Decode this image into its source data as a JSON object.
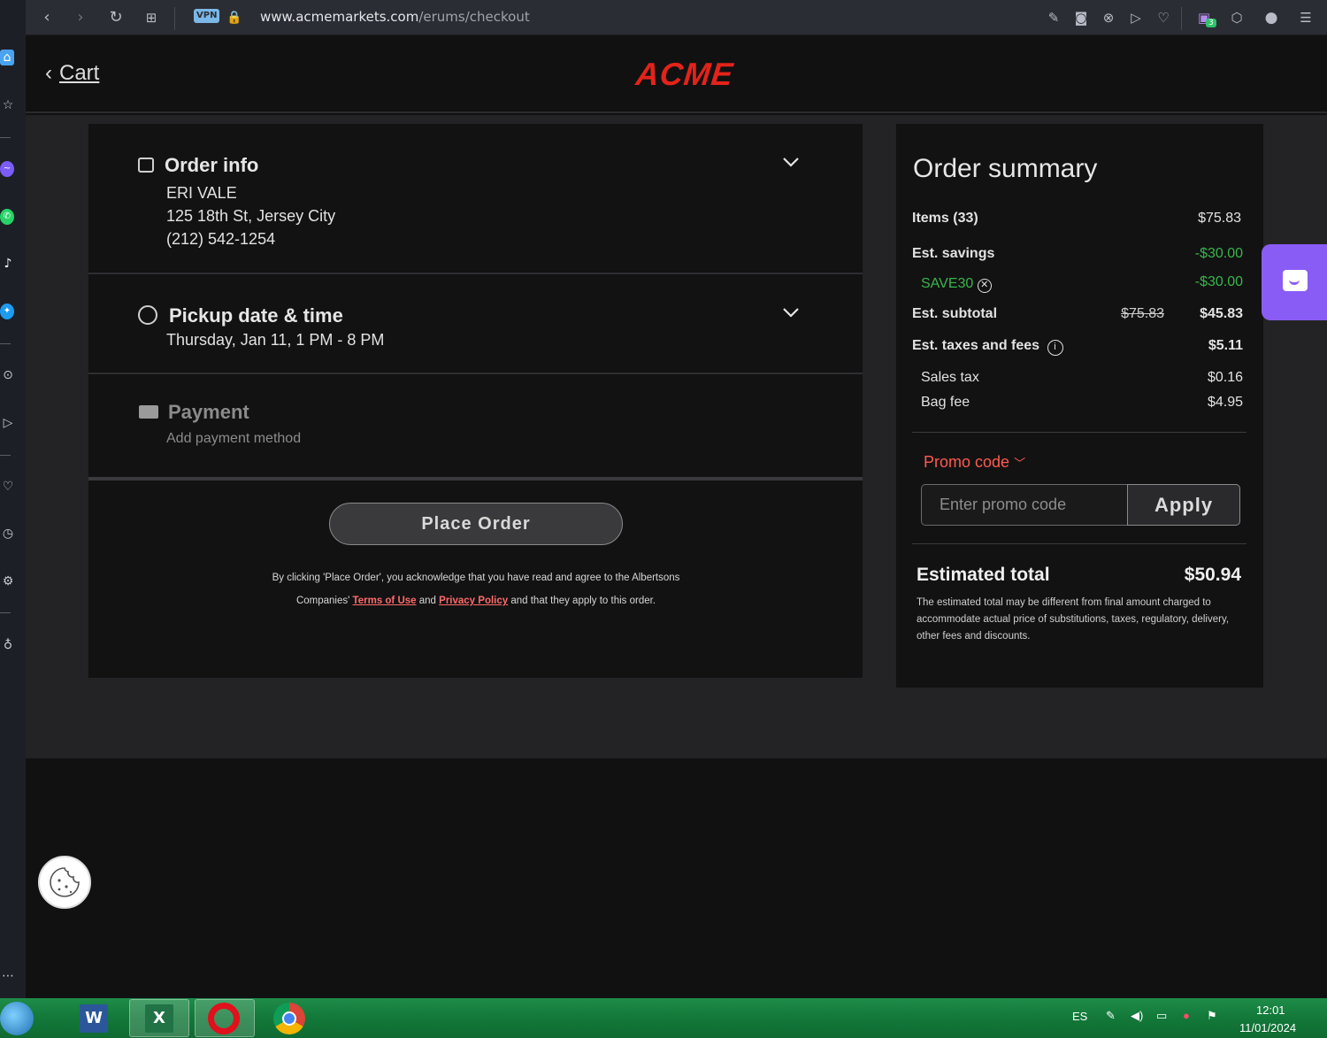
{
  "browser": {
    "vpn_label": "VPN",
    "url_domain": "www.acmemarkets.com",
    "url_path": "/erums/checkout",
    "badge_count": "3"
  },
  "header": {
    "back_label": "Cart",
    "logo_text": "ACME"
  },
  "order_info": {
    "title": "Order info",
    "name": "ERI VALE",
    "address": "125 18th St, Jersey City",
    "phone": "(212) 542-1254"
  },
  "pickup": {
    "title": "Pickup date & time",
    "when": "Thursday, Jan 11, 1 PM - 8 PM"
  },
  "payment": {
    "title": "Payment",
    "subtitle": "Add payment method"
  },
  "place_order": {
    "button_label": "Place Order",
    "legal_prefix": "By clicking 'Place Order', you acknowledge that you have read and agree to the Albertsons Companies'",
    "terms_link": "Terms of Use",
    "and": "and",
    "privacy_link": "Privacy Policy",
    "legal_suffix": "and that they apply to this order."
  },
  "summary": {
    "title": "Order summary",
    "items_label": "Items (33)",
    "items_value": "$75.83",
    "savings_label": "Est. savings",
    "savings_value": "-$30.00",
    "coupon_code": "SAVE30",
    "coupon_value": "-$30.00",
    "subtotal_label": "Est. subtotal",
    "subtotal_original": "$75.83",
    "subtotal_value": "$45.83",
    "taxes_label": "Est. taxes and fees",
    "taxes_value": "$5.11",
    "sales_tax_label": "Sales tax",
    "sales_tax_value": "$0.16",
    "bag_fee_label": "Bag fee",
    "bag_fee_value": "$4.95",
    "promo_toggle": "Promo code",
    "promo_placeholder": "Enter promo code",
    "apply_label": "Apply",
    "total_label": "Estimated total",
    "total_value": "$50.94",
    "total_note": "The estimated total may be different from final amount charged to accommodate actual price of substitutions, taxes, regulatory, delivery, other fees and discounts."
  },
  "taskbar": {
    "lang": "ES",
    "time": "12:01",
    "date": "11/01/2024"
  },
  "colors": {
    "brand_red": "#e2231a",
    "savings_green": "#39b54a",
    "promo_orange": "#ff5a4e",
    "chat_purple": "#8a5cf6"
  }
}
